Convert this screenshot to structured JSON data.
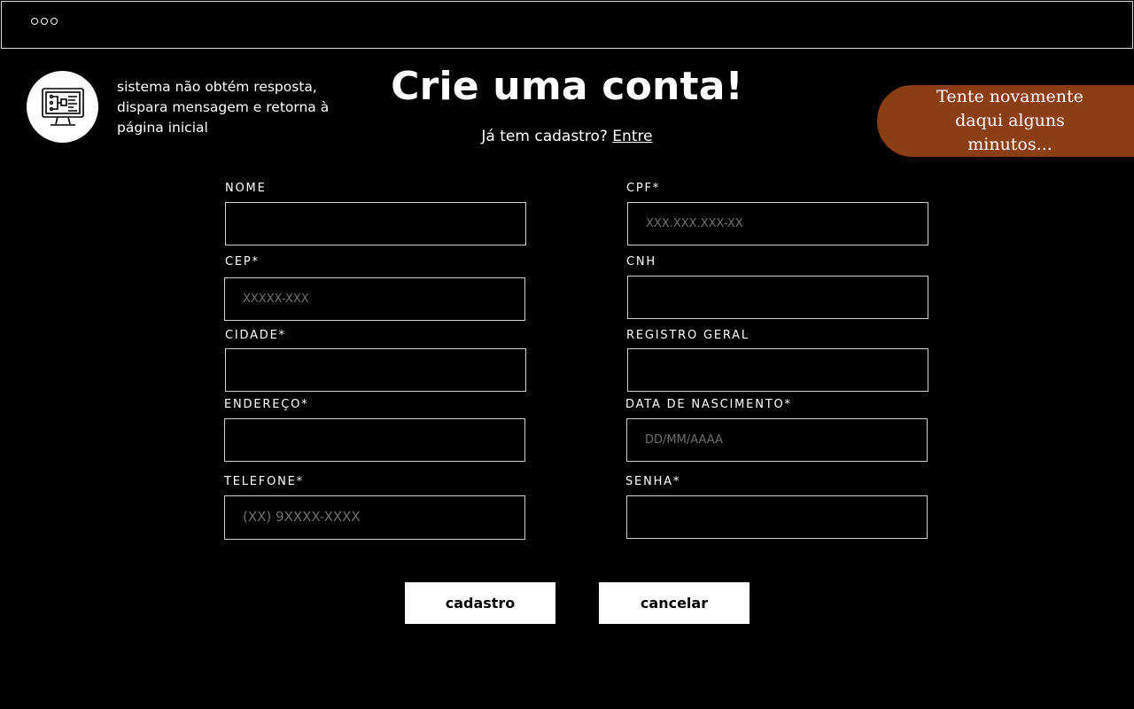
{
  "window": {
    "controls_icon": "window-dots-icon"
  },
  "note": {
    "icon": "computer-monitor-icon",
    "text": "sistema não obtém resposta, dispara mensagem e retorna à página inicial"
  },
  "header": {
    "title": "Crie uma conta!",
    "login_prompt": "Já tem cadastro?",
    "login_link": "Entre"
  },
  "toast": {
    "message": "Tente novamente daqui alguns minutos...",
    "color": "#8b3d14"
  },
  "form": {
    "nome": {
      "label": "NOME",
      "placeholder": ""
    },
    "cpf": {
      "label": "CPF*",
      "placeholder": "XXX.XXX.XXX-XX"
    },
    "cep": {
      "label": "CEP*",
      "placeholder": "XXXXX-XXX"
    },
    "cnh": {
      "label": "CNH",
      "placeholder": ""
    },
    "cidade": {
      "label": "CIDADE*",
      "placeholder": ""
    },
    "rg": {
      "label": "REGISTRO GERAL",
      "placeholder": ""
    },
    "endereco": {
      "label": "ENDEREÇO*",
      "placeholder": ""
    },
    "nascimento": {
      "label": "DATA DE NASCIMENTO*",
      "placeholder": "DD/MM/AAAA"
    },
    "telefone": {
      "label": "TELEFONE*",
      "placeholder": "(XX) 9XXXX-XXXX"
    },
    "senha": {
      "label": "SENHA*",
      "placeholder": ""
    }
  },
  "actions": {
    "submit_label": "cadastro",
    "cancel_label": "cancelar"
  }
}
